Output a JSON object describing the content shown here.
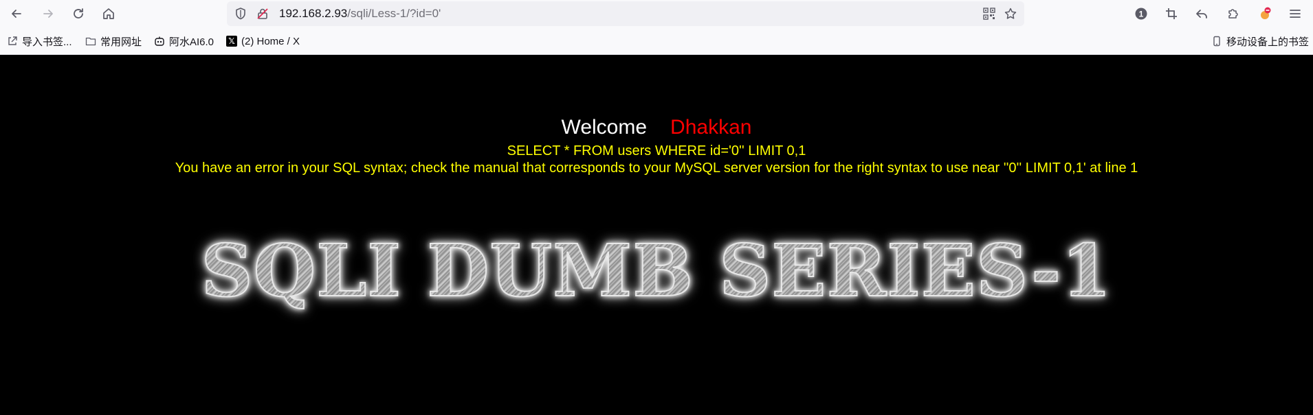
{
  "browser": {
    "url_host": "192.168.2.93",
    "url_path": "/sqli/Less-1/?id=0'",
    "nav": {
      "back_icon": "arrow-left-icon",
      "forward_icon": "arrow-right-icon",
      "reload_icon": "reload-icon",
      "home_icon": "home-icon"
    },
    "badge_count": "1"
  },
  "bookmarks": {
    "items": [
      {
        "label": "导入书签...",
        "icon": "import-icon"
      },
      {
        "label": "常用网址",
        "icon": "folder-icon"
      },
      {
        "label": "阿水AI6.0",
        "icon": "bot-icon"
      },
      {
        "label": "(2) Home / X",
        "icon": "x-logo-icon"
      }
    ],
    "mobile_label": "移动设备上的书签"
  },
  "page": {
    "welcome": "Welcome",
    "name": "Dhakkan",
    "query": "SELECT * FROM users WHERE id='0'' LIMIT 0,1",
    "error": "You have an error in your SQL syntax; check the manual that corresponds to your MySQL server version for the right syntax to use near ''0'' LIMIT 0,1' at line 1",
    "banner": "SQLI DUMB SERIES-1"
  },
  "colors": {
    "background": "#000000",
    "welcome": "#ffffff",
    "name": "#ff0000",
    "sql_text": "#ffff00"
  }
}
